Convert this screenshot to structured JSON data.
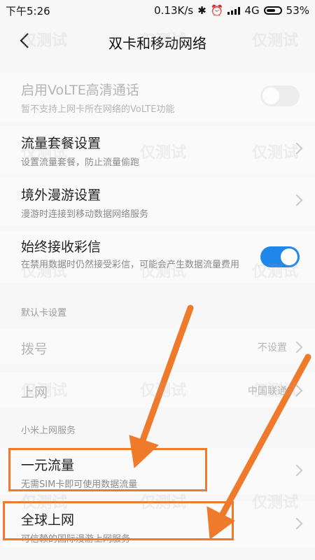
{
  "status": {
    "time": "下午5:26",
    "network_speed": "0.13K/s",
    "network_type": "4G",
    "battery": "53%"
  },
  "header": {
    "title": "双卡和移动网络"
  },
  "settings": {
    "volte": {
      "label": "启用VoLTE高清通话",
      "sub": "暂不支持上网卡所在网络的VoLTE功能",
      "toggle": "off"
    },
    "data_plan": {
      "label": "流量套餐设置",
      "sub": "设置流量套餐，防止流量偷跑"
    },
    "roaming": {
      "label": "境外漫游设置",
      "sub": "漫游时连接到移动数据网络服务"
    },
    "mms": {
      "label": "始终接收彩信",
      "sub": "在禁用数据时仍然接受彩信，可能会产生数据流量费用",
      "toggle": "on"
    }
  },
  "default_card": {
    "section_title": "默认卡设置",
    "dial": {
      "label": "拨号",
      "value": "不设置"
    },
    "internet": {
      "label": "上网",
      "value": "中国联通"
    }
  },
  "mi_services": {
    "section_title": "小米上网服务",
    "one_yuan": {
      "label": "一元流量",
      "sub": "无需SIM卡即可使用数据流量"
    },
    "global": {
      "label": "全球上网",
      "sub": "可信赖的国际漫游上网服务"
    }
  },
  "watermark_text": "仅测试",
  "colors": {
    "accent_toggle": "#1f86ea",
    "annotation_orange": "#f07a2b"
  }
}
